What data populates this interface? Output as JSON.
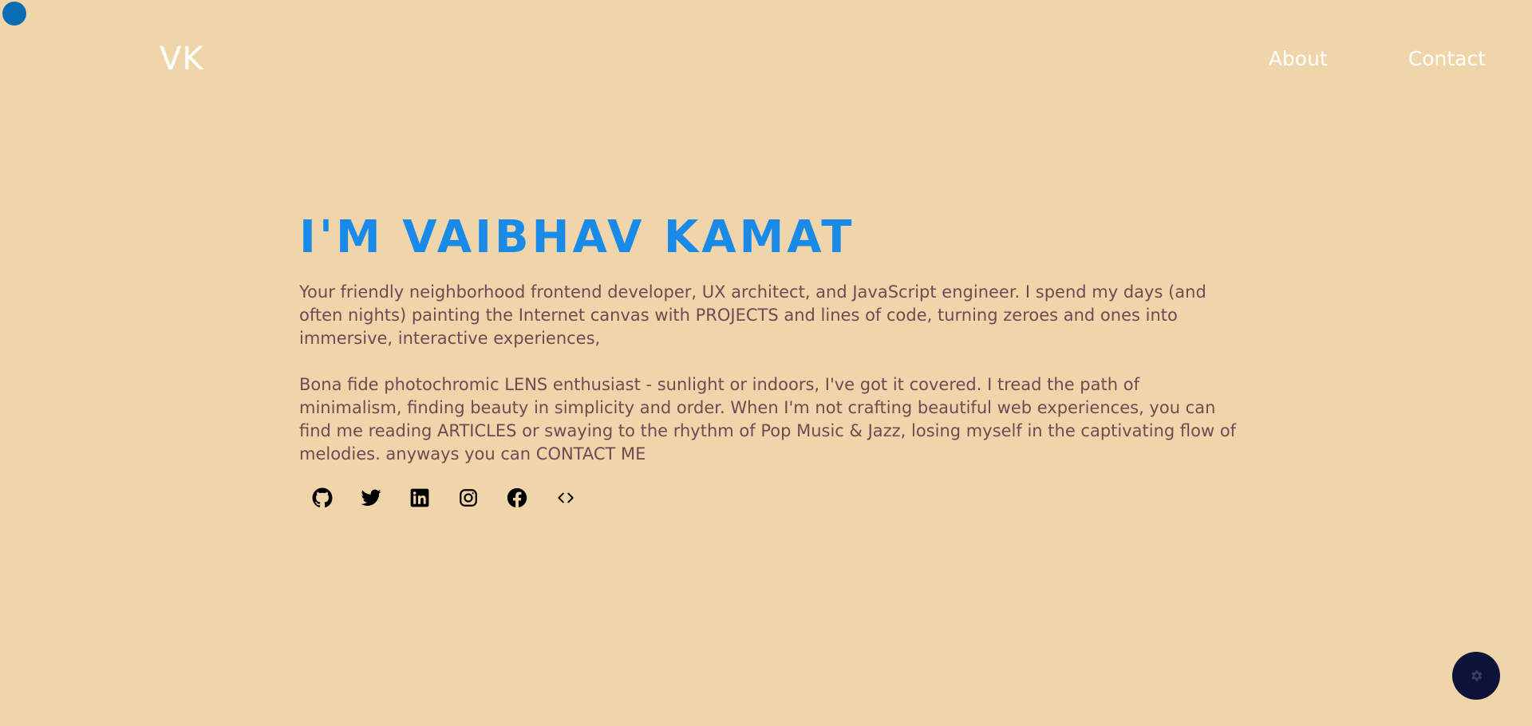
{
  "header": {
    "logo": "VK",
    "nav": [
      {
        "label": "About"
      },
      {
        "label": "Contact"
      }
    ]
  },
  "hero": {
    "title": "I'M VAIBHAV KAMAT",
    "paragraph1": "Your friendly neighborhood frontend developer, UX architect, and JavaScript engineer. I spend my days (and often nights) painting the Internet canvas with PROJECTS and lines of code, turning zeroes and ones into immersive, interactive experiences,",
    "paragraph2": "Bona fide photochromic LENS enthusiast - sunlight or indoors, I've got it covered. I tread the path of minimalism, finding beauty in simplicity and order. When I'm not crafting beautiful web experiences, you can find me reading ARTICLES or swaying to the rhythm of Pop Music & Jazz, losing myself in the captivating flow of melodies. anyways you can CONTACT ME"
  },
  "socials": [
    {
      "icon": "github-icon"
    },
    {
      "icon": "twitter-icon"
    },
    {
      "icon": "linkedin-icon"
    },
    {
      "icon": "instagram-icon"
    },
    {
      "icon": "facebook-icon"
    },
    {
      "icon": "code-icon"
    }
  ],
  "colors": {
    "background": "#f0d5aa",
    "accent": "#1a8ae8",
    "body_text": "#6f4a55",
    "nav_text": "#ffffff",
    "cursor": "#0b6cb4",
    "fab": "#0d1238"
  },
  "fab": {
    "icon": "gear-icon"
  }
}
